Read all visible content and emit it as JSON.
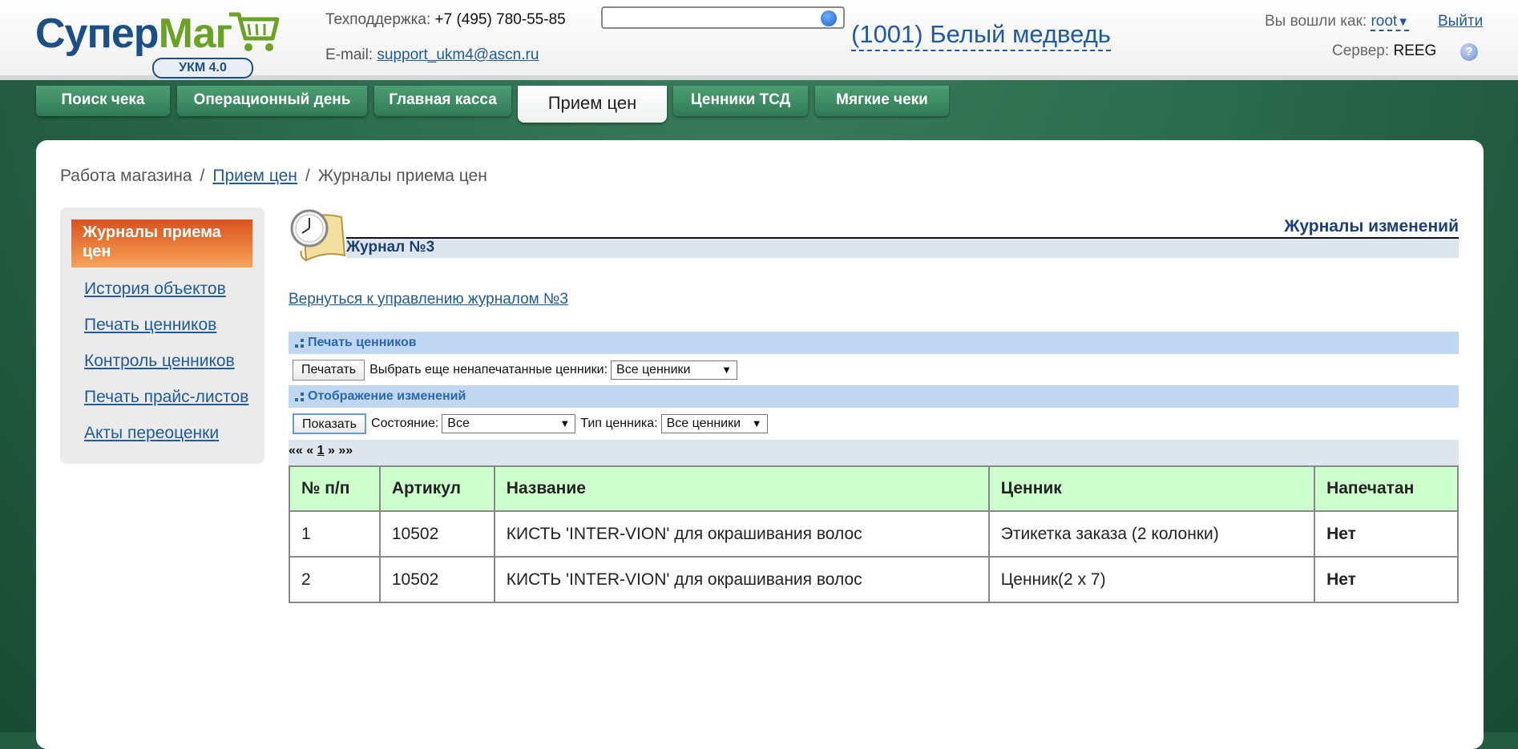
{
  "header": {
    "logo": {
      "part1": "Супер",
      "part2": "Маг",
      "badge": "УКМ 4.0"
    },
    "support_label": "Техподдержка:",
    "support_phone": "+7 (495) 780-55-85",
    "email_label": "E-mail:",
    "email": "support_ukm4@ascn.ru",
    "search": {
      "value": "",
      "placeholder": ""
    },
    "store": "(1001) Белый медведь",
    "logged_in_label": "Вы вошли как:",
    "user": "root",
    "user_arrow": "▼",
    "logout": "Выйти",
    "server_label": "Сервер:",
    "server": "REEG",
    "help": "?"
  },
  "tabs": [
    {
      "label": "Поиск чека",
      "active": false
    },
    {
      "label": "Операционный день",
      "active": false
    },
    {
      "label": "Главная касса",
      "active": false
    },
    {
      "label": "Прием цен",
      "active": true
    },
    {
      "label": "Ценники ТСД",
      "active": false
    },
    {
      "label": "Мягкие чеки",
      "active": false
    }
  ],
  "breadcrumb": {
    "root": "Работа магазина",
    "sep": "/",
    "link": "Прием цен",
    "current": "Журналы приема цен"
  },
  "sidebar": {
    "active": "Журналы приема цен",
    "items": [
      "История объектов",
      "Печать ценников",
      "Контроль ценников",
      "Печать прайс-листов",
      "Акты переоценки"
    ]
  },
  "main": {
    "heading": "Журналы изменений",
    "journal": "Журнал №3",
    "back_link": "Вернуться к управлению журналом №3",
    "print_section": {
      "title": "Печать ценников",
      "button": "Печатать",
      "select_label": "Выбрать еще ненапечатанные ценники:",
      "select_value": "Все ценники"
    },
    "display_section": {
      "title": "Отображение изменений",
      "button": "Показать",
      "state_label": "Состояние:",
      "state_value": "Все",
      "type_label": "Тип ценника:",
      "type_value": "Все ценники"
    },
    "pager": {
      "first": "««",
      "prev": "«",
      "page": "1",
      "next": "»",
      "last": "»»"
    },
    "table": {
      "headers": [
        "№ п/п",
        "Артикул",
        "Название",
        "Ценник",
        "Напечатан"
      ],
      "rows": [
        [
          "1",
          "10502",
          "КИСТЬ 'INTER-VION' для окрашивания волос",
          "Этикетка заказа (2 колонки)",
          "Нет"
        ],
        [
          "2",
          "10502",
          "КИСТЬ 'INTER-VION' для окрашивания волос",
          "Ценник(2 x 7)",
          "Нет"
        ]
      ]
    }
  },
  "colors": {
    "background_green": "#2b6a4c",
    "tab_green": "#3f8c63",
    "link_blue": "#1f5a9c",
    "header_green": "#ccffcc",
    "section_blue": "#bfd7f0",
    "active_orange": "#e06428",
    "no_red": "#c00000"
  }
}
